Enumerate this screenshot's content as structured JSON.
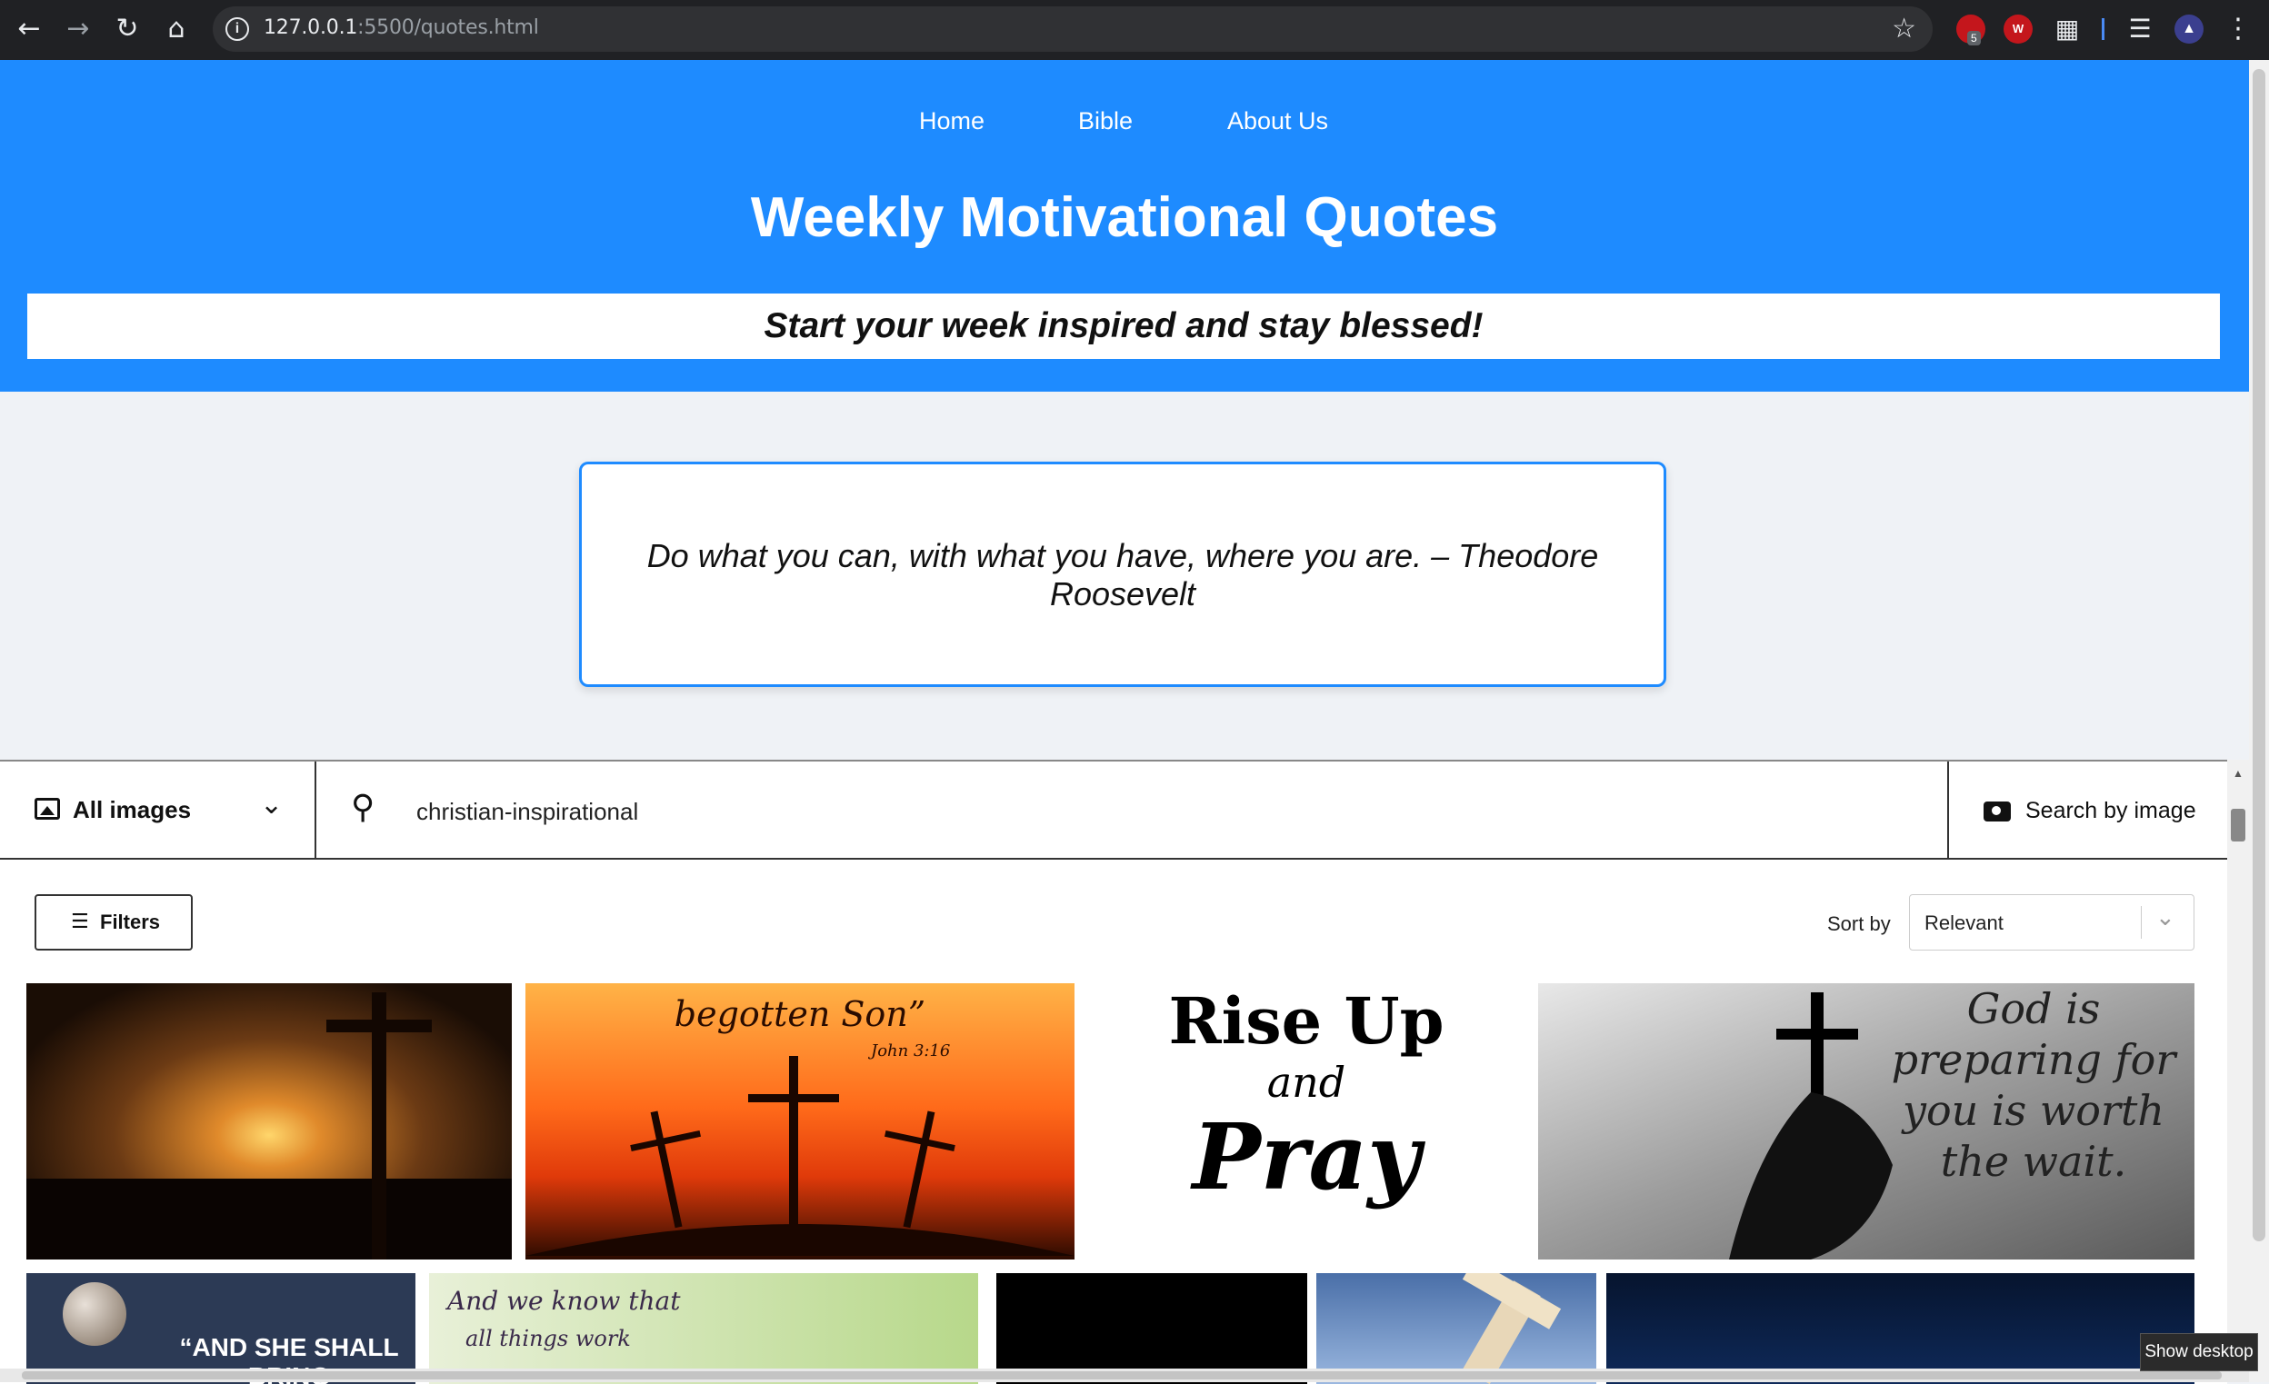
{
  "browser": {
    "url_host": "127.0.0.1",
    "url_rest": ":5500/quotes.html",
    "ext_badge": "5",
    "ext_w_label": "W"
  },
  "nav": {
    "home": "Home",
    "bible": "Bible",
    "about": "About Us"
  },
  "header": {
    "title": "Weekly Motivational Quotes",
    "tagline": "Start your week inspired and stay blessed!"
  },
  "quote": {
    "text": "Do what you can, with what you have, where you are. – Theodore Roosevelt"
  },
  "search": {
    "type_label": "All images",
    "query": "christian-inspirational",
    "by_image_label": "Search by image",
    "filters_label": "Filters",
    "sort_label": "Sort by",
    "sort_value": "Relevant"
  },
  "tiles": {
    "t2_line1": "begotten Son”",
    "t2_ref": "John 3:16",
    "t3_l1": "Rise Up",
    "t3_l2": "and",
    "t3_l3": "Pray",
    "t4_l1": "God is",
    "t4_l2": "preparing for",
    "t4_l3": "you is worth",
    "t4_l4": "the wait.",
    "t5_text": "“AND SHE SHALL BRING",
    "t6_l1": "And we know that",
    "t6_l2": "all things work"
  },
  "tooltip": "Show desktop"
}
